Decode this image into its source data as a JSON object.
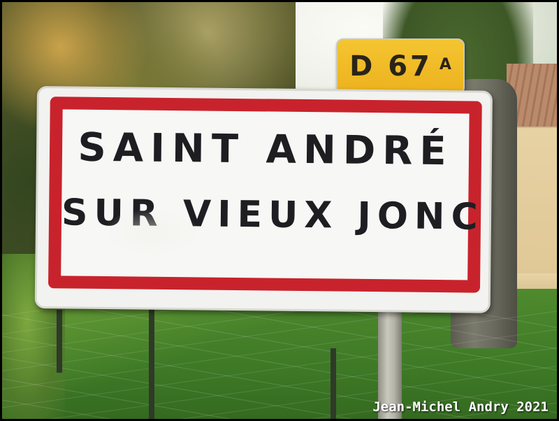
{
  "road_number_sign": {
    "main": "D 67",
    "suffix": "A",
    "color": "#f0bb26"
  },
  "town_sign": {
    "line1": "SAINT ANDRÉ",
    "line2": "SUR VIEUX JONC",
    "border_color": "#c8232c"
  },
  "photo_credit": "Jean-Michel Andry 2021"
}
